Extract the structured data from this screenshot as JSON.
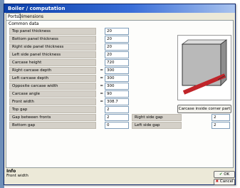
{
  "window": {
    "title": "Boiler / computation"
  },
  "tabs": [
    {
      "label": "Ports",
      "active": true
    },
    {
      "label": "Dimensions",
      "active": false
    }
  ],
  "section": {
    "title": "Common data"
  },
  "fields": [
    {
      "label": "Top panel thickness",
      "prefix": "",
      "value": "20"
    },
    {
      "label": "Bottom panel thickness",
      "prefix": "",
      "value": "20"
    },
    {
      "label": "Right side panel thickness",
      "prefix": "",
      "value": "20"
    },
    {
      "label": "Left side panel thickness",
      "prefix": "",
      "value": "20"
    },
    {
      "label": "Carcase height",
      "prefix": "",
      "value": "720"
    },
    {
      "label": "Right carcase depth",
      "prefix": "=",
      "value": "300"
    },
    {
      "label": "Left carcase depth",
      "prefix": "=",
      "value": "300"
    },
    {
      "label": "Opposite carcase width",
      "prefix": "=",
      "value": "300"
    },
    {
      "label": "Carcase angle",
      "prefix": "=",
      "value": "90"
    },
    {
      "label": "Front width",
      "prefix": "=",
      "value": "308.7"
    },
    {
      "label": "Top gap",
      "prefix": "",
      "value": "2"
    },
    {
      "label": "Gap between fronts",
      "prefix": "",
      "value": "2"
    },
    {
      "label": "Bottom gap",
      "prefix": "",
      "value": "0"
    }
  ],
  "side_fields": [
    {
      "label": "Right side gap",
      "value": "2"
    },
    {
      "label": "Left side gap",
      "value": "2"
    }
  ],
  "preview": {
    "button_label": "Carcase inside corner part"
  },
  "info": {
    "title": "Info",
    "text": "Front width"
  },
  "buttons": {
    "ok_label": "OK",
    "cancel_label": "Cancel"
  },
  "icons": {
    "ok": "check-icon",
    "cancel": "cross-icon"
  },
  "colors": {
    "title_bar": "#0a3fa8",
    "preview_front": "#c0252a",
    "preview_carcase": "#b9b9b9"
  }
}
